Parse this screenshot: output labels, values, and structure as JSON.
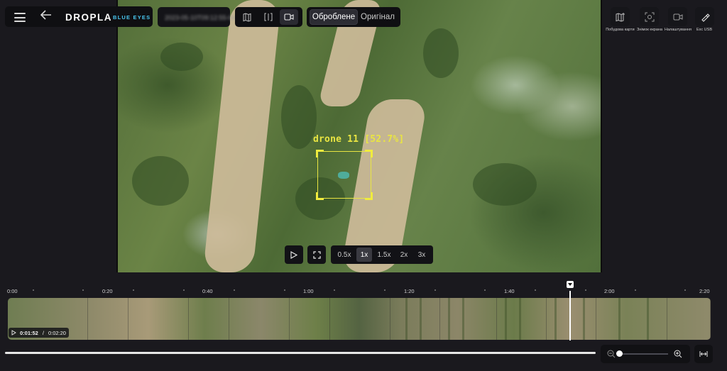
{
  "app": {
    "logo": "DROPLA",
    "logo_sub": "BLUE EYES",
    "file_name": "2023-05-10T09:12:55-0400"
  },
  "icons": {
    "menu": "hamburger-menu-icon",
    "back": "arrow-left-icon",
    "map_view": "map-icon",
    "split_view": "split-view-icon",
    "video_view": "video-camera-icon",
    "build_map": "map-plus-icon",
    "screenshot": "camera-capture-icon",
    "settings": "video-settings-icon",
    "usb_export": "usb-drive-icon",
    "play": "play-icon",
    "fullscreen": "fullscreen-icon",
    "zoom_out": "zoom-out-icon",
    "zoom_in": "zoom-in-icon",
    "fit": "fit-to-width-icon"
  },
  "mode_toggle": {
    "processed": "Оброблене",
    "original": "Оригінал",
    "selected": "Оброблене"
  },
  "tools": {
    "build_map": "Побудова карти",
    "screenshot": "Знімок екрана",
    "settings": "Налаштування",
    "usb_export": "Exc USB"
  },
  "detection": {
    "label": "drone 11 [52.7%]",
    "color": "#e9e542"
  },
  "playback": {
    "speeds": [
      "0.5x",
      "1x",
      "1.5x",
      "2x",
      "3x"
    ],
    "selected_speed": "1x",
    "current_time": "0:01:52",
    "separator": "/",
    "total_time": "0:02:20",
    "progress_fraction": 0.8
  },
  "timeline": {
    "ticks": [
      "0:00",
      "0:20",
      "0:40",
      "1:00",
      "1:20",
      "1:40",
      "2:00",
      "2:20"
    ]
  },
  "zoom": {
    "level_fraction": 0.0
  }
}
